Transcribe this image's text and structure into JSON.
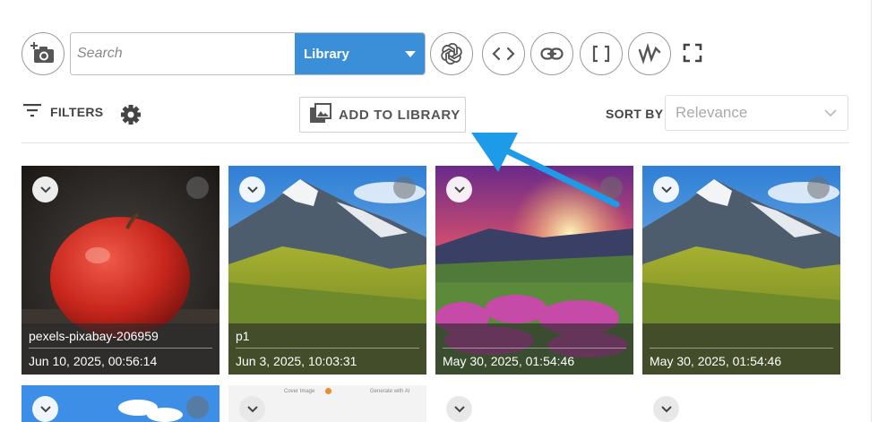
{
  "toolbar": {
    "search_placeholder": "Search",
    "source_select_value": "Library",
    "icons": [
      "add-photo-icon",
      "openai-icon",
      "code-icon",
      "link-icon",
      "brackets-icon",
      "wave-icon",
      "fullscreen-icon"
    ]
  },
  "filters": {
    "filters_label": "FILTERS",
    "add_to_library_label": "ADD TO LIBRARY",
    "sort_by_label": "SORT BY",
    "sort_value": "Relevance"
  },
  "images": [
    {
      "name": "pexels-pixabay-206959",
      "date": "Jun 10, 2025, 00:56:14"
    },
    {
      "name": "p1",
      "date": "Jun 3, 2025, 10:03:31"
    },
    {
      "name": "",
      "date": "May 30, 2025, 01:54:46"
    },
    {
      "name": "",
      "date": "May 30, 2025, 01:54:46"
    }
  ],
  "partial_row_text": {
    "cover_image": "Cover Image",
    "generate_with_ai": "Generate with AI"
  },
  "colors": {
    "accent": "#3b8ed8",
    "arrow": "#1e9be8"
  }
}
